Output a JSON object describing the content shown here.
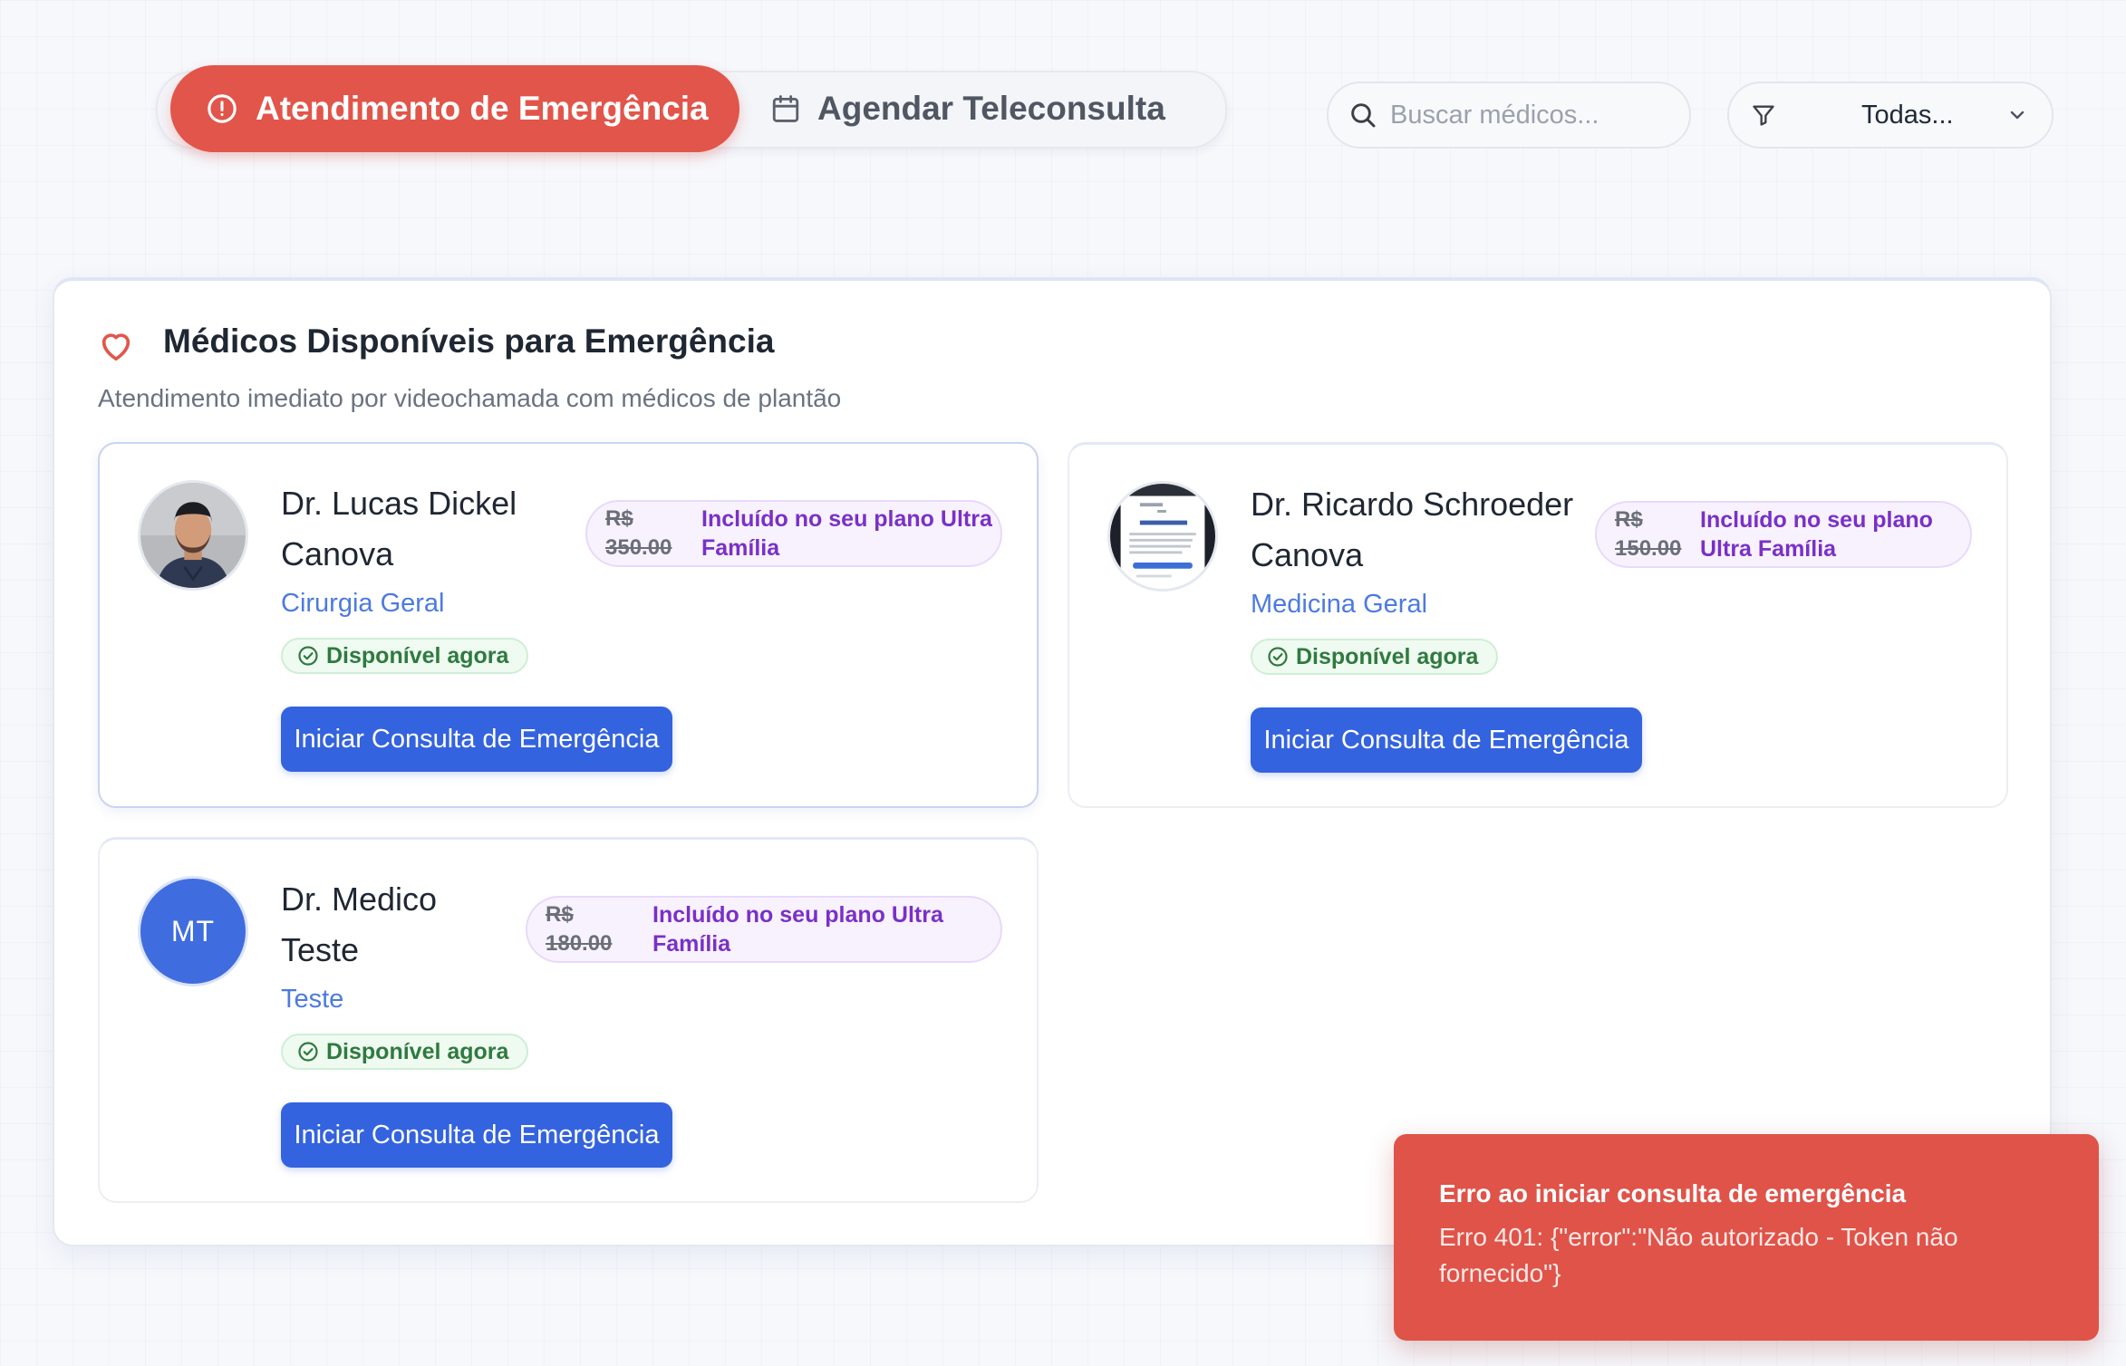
{
  "tabs": {
    "emergency_label": "Atendimento de Emergência",
    "teleconsult_label": "Agendar Teleconsulta"
  },
  "search": {
    "placeholder": "Buscar médicos...",
    "value": ""
  },
  "filter": {
    "selected": "Todas..."
  },
  "panel": {
    "title": "Médicos Disponíveis para Emergência",
    "subtitle": "Atendimento imediato por videochamada com médicos de plantão"
  },
  "doctors": [
    {
      "name_line1": "Dr. Lucas Dickel",
      "name_line2": "Canova",
      "specialty": "Cirurgia Geral",
      "availability": "Disponível agora",
      "price_currency": "R$",
      "price_value": "350.00",
      "plan_line1": "Incluído no seu plano Ultra",
      "plan_line2": "Família",
      "button_label": "Iniciar Consulta de Emergência",
      "avatar": "photo"
    },
    {
      "name_line1": "Dr. Ricardo Schroeder",
      "name_line2": "Canova",
      "specialty": "Medicina Geral",
      "availability": "Disponível agora",
      "price_currency": "R$",
      "price_value": "150.00",
      "plan_line1": "Incluído no seu plano",
      "plan_line2": "Ultra Família",
      "button_label": "Iniciar Consulta de Emergência",
      "avatar": "screenshot-thumbnail"
    },
    {
      "name_line1": "Dr. Medico",
      "name_line2": "Teste",
      "specialty": "Teste",
      "availability": "Disponível agora",
      "price_currency": "R$",
      "price_value": "180.00",
      "plan_line1": "Incluído no seu plano Ultra",
      "plan_line2": "Família",
      "button_label": "Iniciar Consulta de Emergência",
      "avatar_initials": "MT"
    }
  ],
  "toast": {
    "title": "Erro ao iniciar consulta de emergência",
    "message": "Erro 401: {\"error\":\"Não autorizado - Token não fornecido\"}"
  },
  "icons": {
    "emergency_tab": "alert-circle-icon",
    "teleconsult_tab": "calendar-icon",
    "search": "search-icon",
    "filter": "filter-icon",
    "dropdown": "chevron-down-icon",
    "panel": "heart-icon",
    "availability": "check-circle-icon"
  },
  "colors": {
    "emergency": "#e2554a",
    "primary": "#3463df",
    "specialty": "#4d7ae0",
    "available": "#2f7a3f",
    "plan": "#7a30c7",
    "toast": "#df5349"
  }
}
